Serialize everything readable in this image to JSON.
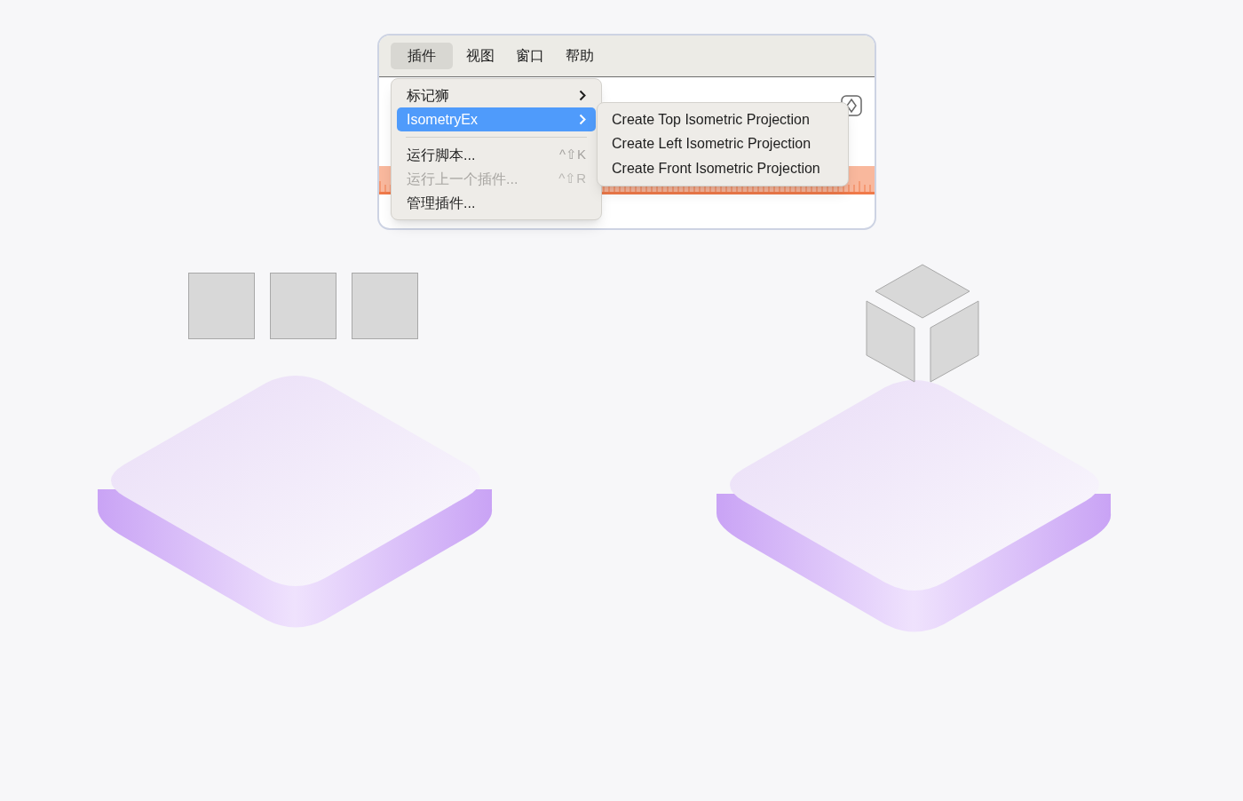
{
  "menubar": [
    {
      "label": "插件",
      "selected": true
    },
    {
      "label": "视图",
      "selected": false
    },
    {
      "label": "窗口",
      "selected": false
    },
    {
      "label": "帮助",
      "selected": false
    }
  ],
  "menu": [
    {
      "kind": "submenu",
      "label": "标记狮",
      "selected": false,
      "disabled": false
    },
    {
      "kind": "submenu",
      "label": "IsometryEx",
      "selected": true,
      "disabled": false
    },
    {
      "kind": "separator"
    },
    {
      "kind": "command",
      "label": "运行脚本...",
      "shortcut": "^⇧K",
      "selected": false,
      "disabled": false
    },
    {
      "kind": "command",
      "label": "运行上一个插件...",
      "shortcut": "^⇧R",
      "selected": false,
      "disabled": true
    },
    {
      "kind": "command",
      "label": "管理插件...",
      "selected": false,
      "disabled": false
    }
  ],
  "submenu": [
    {
      "label": "Create Top Isometric Projection"
    },
    {
      "label": "Create Left Isometric Projection"
    },
    {
      "label": "Create Front Isometric Projection"
    }
  ]
}
